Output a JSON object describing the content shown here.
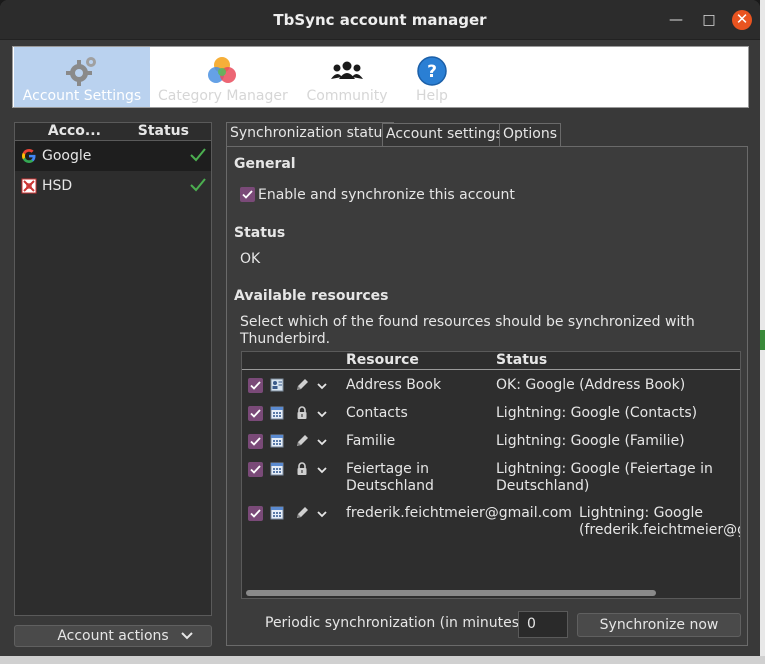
{
  "window": {
    "title": "TbSync account manager",
    "minimize": "—",
    "maximize": "□",
    "close": "✕"
  },
  "categories": [
    {
      "label": "Account Settings",
      "icon": "gear-icon",
      "active": true
    },
    {
      "label": "Category Manager",
      "icon": "color-circles-icon",
      "active": false
    },
    {
      "label": "Community",
      "icon": "people-icon",
      "active": false
    },
    {
      "label": "Help",
      "icon": "question-icon",
      "active": false
    }
  ],
  "accounts": {
    "header": {
      "account": "Acco...",
      "status": "Status"
    },
    "items": [
      {
        "name": "Google",
        "icon": "google-icon",
        "status_icon": "check-icon"
      },
      {
        "name": "HSD",
        "icon": "hsd-icon",
        "status_icon": "check-icon"
      }
    ],
    "actions_label": "Account actions"
  },
  "tabs": [
    "Synchronization status",
    "Account settings",
    "Options"
  ],
  "general": {
    "heading": "General",
    "enable_label": "Enable and synchronize this account"
  },
  "status": {
    "heading": "Status",
    "value": "OK"
  },
  "resources": {
    "heading": "Available resources",
    "description_line1": "Select which of the found resources should be synchronized with",
    "description_line2": "Thunderbird.",
    "columns": {
      "resource": "Resource",
      "status": "Status"
    },
    "rows": [
      {
        "icon": "address-book-icon",
        "mode": "pencil-icon",
        "name": [
          "Address Book"
        ],
        "status": [
          "OK: Google (Address Book)"
        ]
      },
      {
        "icon": "calendar-icon",
        "mode": "lock-icon",
        "name": [
          "Contacts"
        ],
        "status": [
          "Lightning: Google (Contacts)"
        ]
      },
      {
        "icon": "calendar-icon",
        "mode": "pencil-icon",
        "name": [
          "Familie"
        ],
        "status": [
          "Lightning: Google (Familie)"
        ]
      },
      {
        "icon": "calendar-icon",
        "mode": "lock-icon",
        "name": [
          "Feiertage in",
          "Deutschland"
        ],
        "status": [
          "Lightning: Google (Feiertage in",
          "Deutschland)"
        ]
      },
      {
        "icon": "calendar-icon",
        "mode": "pencil-icon",
        "name": [
          "frederik.feichtmeier@gmail.com"
        ],
        "status": [
          "Lightning: Google",
          "(frederik.feichtmeier@g"
        ]
      }
    ]
  },
  "periodic": {
    "label": "Periodic synchronization (in minutes)",
    "value": "0"
  },
  "sync_button": "Synchronize now",
  "colors": {
    "accent_checkbox": "#7a4a78",
    "check_green": "#4caf50",
    "close_button": "#e95420",
    "category_active": "#bad2ef"
  }
}
